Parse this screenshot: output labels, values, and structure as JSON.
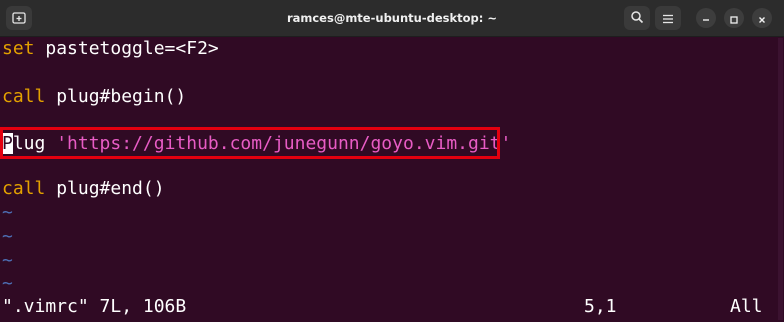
{
  "window": {
    "title": "ramces@mte-ubuntu-desktop: ~"
  },
  "icons": {
    "new_tab": "new-tab-icon",
    "search": "search-icon",
    "menu": "hamburger-menu-icon",
    "minimize": "minimize-icon",
    "maximize": "maximize-icon",
    "close": "close-icon"
  },
  "editor": {
    "line1": {
      "keyword": "set",
      "rest": " pastetoggle=<F2>"
    },
    "line2": {
      "keyword": "call",
      "rest": " plug#begin()"
    },
    "line3": {
      "cursor_char": "P",
      "rest": "lug ",
      "string": "'https://github.com/junegunn/goyo.vim.git'"
    },
    "line4": {
      "keyword": "call",
      "rest": " plug#end()"
    },
    "tildes": [
      "~",
      "~",
      "~",
      "~"
    ]
  },
  "statusline": {
    "file_info": "\".vimrc\" 7L, 106B",
    "position": "5,1",
    "scroll": "All"
  },
  "colors": {
    "background": "#300a24",
    "keyword": "#e3a100",
    "string": "#e85cc5",
    "tilde": "#4d6fb5",
    "highlight_box": "#e3000f"
  }
}
